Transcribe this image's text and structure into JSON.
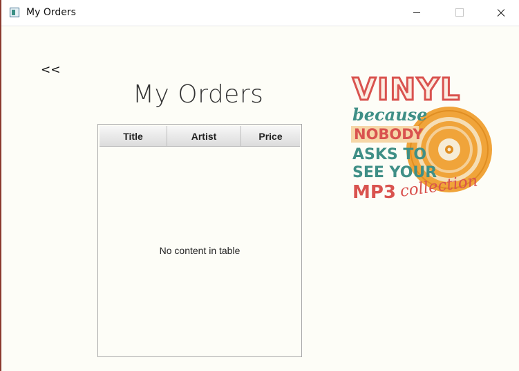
{
  "window": {
    "title": "My Orders"
  },
  "nav": {
    "back_label": "<<"
  },
  "page": {
    "title": "My Orders"
  },
  "table": {
    "columns": [
      "Title",
      "Artist",
      "Price"
    ],
    "placeholder": "No content in table"
  },
  "artwork": {
    "line1": "VINYL",
    "line2": "because",
    "line3": "NOBODY",
    "line4": "ASKS TO",
    "line5": "SEE YOUR",
    "line6a": "MP3",
    "line6b": "collection",
    "colors": {
      "red": "#d9534f",
      "teal": "#3f8f86",
      "orange": "#f0a43a",
      "cream": "#f6ecd6"
    }
  }
}
